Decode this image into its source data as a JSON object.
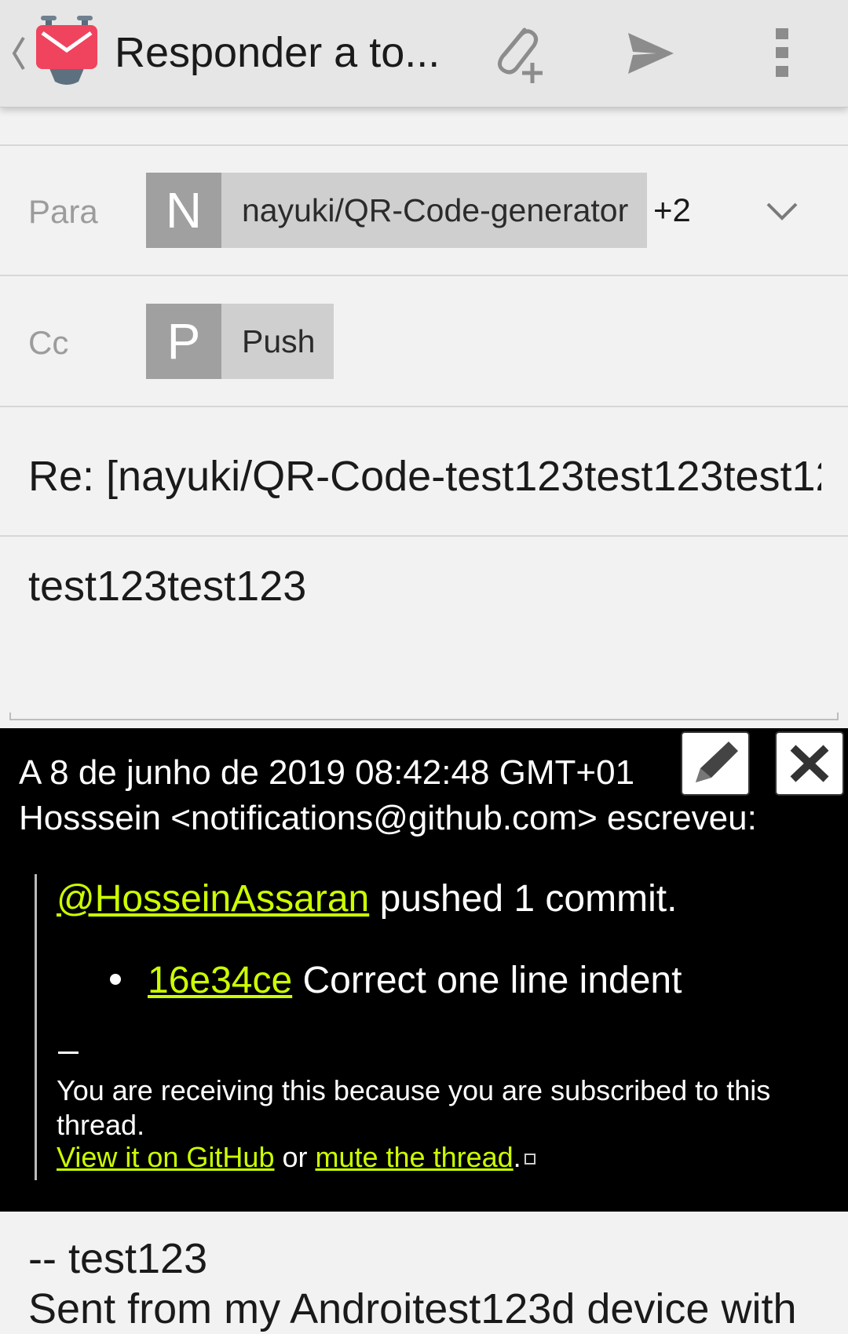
{
  "actionbar": {
    "title": "Responder a to...",
    "logo_color": "#f0435e"
  },
  "to_row": {
    "label": "Para",
    "chip_initial": "N",
    "chip_text": "nayuki/QR-Code-generator",
    "more_count": "+2"
  },
  "cc_row": {
    "label": "Cc",
    "chip_initial": "P",
    "chip_text": "Push"
  },
  "subject": "Re: [nayuki/QR-Code-test123test123test12",
  "body": "test123test123",
  "quote": {
    "header_line1": "A 8 de junho de 2019 08:42:48 GMT+01",
    "header_line2": "Hosssein <notifications@github.com> escreveu:",
    "mention": "@HosseinAssaran",
    "pushed_text": " pushed 1 commit.",
    "commit_hash": "16e34ce",
    "commit_msg": " Correct one line indent",
    "notice": "You are receiving this because you are subscribed to this thread.",
    "view_link": "View it on GitHub",
    "or_text": " or ",
    "mute_link": "mute the thread",
    "period": ".",
    "link_color": "#ccff00"
  },
  "signature": {
    "line1": "-- test123",
    "line2": "Sent from my Androitest123d device with"
  }
}
